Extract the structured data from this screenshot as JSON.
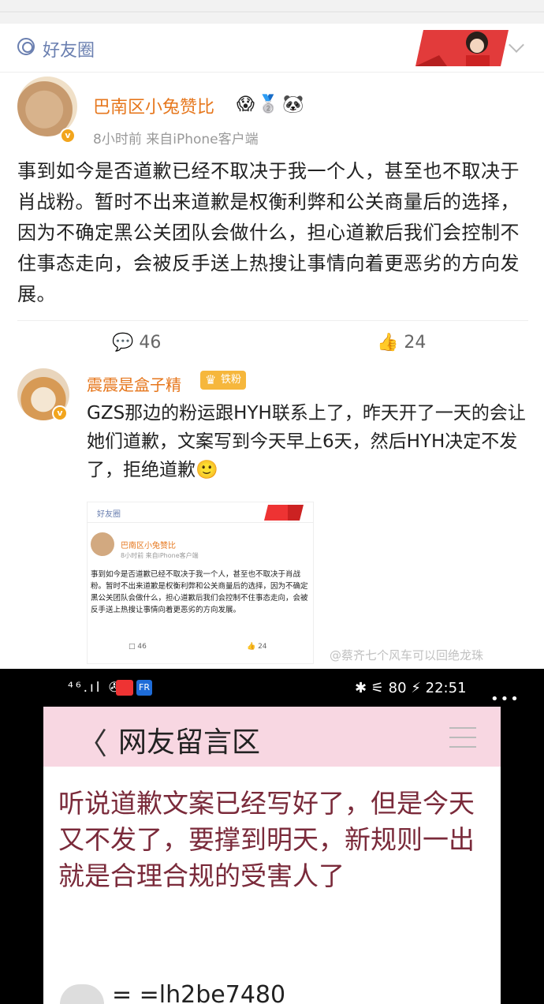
{
  "friends_bar": {
    "label": "好友圈"
  },
  "post": {
    "author": "巴南区小兔赞比",
    "avatar_tag": "",
    "emojis": "😱🥈🐼",
    "meta": "8小时前  来自iPhone客户端",
    "body": "事到如今是否道歉已经不取决于我一个人，甚至也不取决于肖战粉。暂时不出来道歉是权衡利弊和公关商量后的选择，因为不确定黑公关团队会做什么，担心道歉后我们会控制不住事态走向，会被反手送上热搜让事情向着更恶劣的方向发展。",
    "comments": "46",
    "likes": "24"
  },
  "reply": {
    "author": "震震是盒子精",
    "fan_badge": "铁粉",
    "body": "GZS那边的粉运跟HYH联系上了，昨天开了一天的会让她们道歉，文案写到今天早上6天，然后HYH决定不发了，拒绝道歉🙂"
  },
  "mini_screenshot": {
    "label": "好友圈",
    "author": "巴南区小兔赞比",
    "meta": "8小时前  来自iPhone客户端",
    "body": "事到如今是否道歉已经不取决于我一个人，甚至也不取决于肖战粉。暂时不出来道歉是权衡利弊和公关商量后的选择，因为不确定黑公关团队会做什么，担心道歉后我们会控制不住事态走向，会被反手送上热搜让事情向着更恶劣的方向发展。",
    "comments": "46",
    "likes": "24"
  },
  "watermarks": {
    "w2": "@蔡齐七个风车可以回绝龙珠"
  },
  "phone": {
    "status_left": "⁴⁶.ıl ✇",
    "status_fr": "FR",
    "status_right": "✱ ⚟ 80 ⚡ 22:51",
    "page_title": "网友留言区",
    "body": "听说道歉文案已经写好了，但是今天又不发了，要撑到明天，新规则一出就是合理合规的受害人了",
    "username_partial": "= =lh2be7480"
  }
}
